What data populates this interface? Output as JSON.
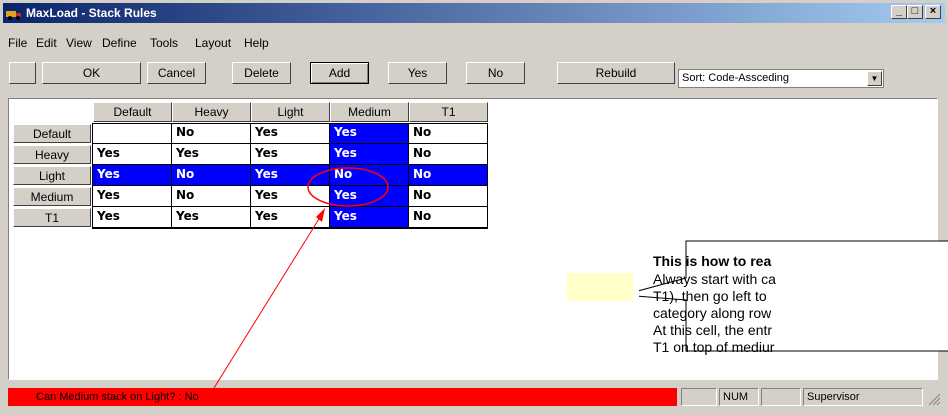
{
  "window": {
    "title": "MaxLoad - Stack Rules",
    "minimize": "_",
    "maximize": "□",
    "close": "×"
  },
  "menu": [
    "File",
    "Edit",
    "View",
    "Define",
    "Tools",
    "Layout",
    "Help"
  ],
  "toolbar": {
    "ok": "OK",
    "cancel": "Cancel",
    "delete": "Delete",
    "add": "Add",
    "yes": "Yes",
    "no": "No",
    "rebuild": "Rebuild",
    "sort_value": "Sort: Code-Assceding"
  },
  "grid": {
    "columns": [
      "Default",
      "Heavy",
      "Light",
      "Medium",
      "T1"
    ],
    "rows": [
      {
        "label": "Default",
        "values": [
          "",
          "No",
          "Yes",
          "Yes",
          "No"
        ]
      },
      {
        "label": "Heavy",
        "values": [
          "Yes",
          "Yes",
          "Yes",
          "Yes",
          "No"
        ]
      },
      {
        "label": "Light",
        "values": [
          "Yes",
          "No",
          "Yes",
          "No",
          "No"
        ]
      },
      {
        "label": "Medium",
        "values": [
          "Yes",
          "No",
          "Yes",
          "Yes",
          "No"
        ]
      },
      {
        "label": "T1",
        "values": [
          "Yes",
          "Yes",
          "Yes",
          "Yes",
          "No"
        ]
      }
    ],
    "selected_row": 2,
    "selected_column": 3
  },
  "callout": {
    "title": "This is how to rea",
    "lines": [
      "Always start with ca",
      "T1), then go left to",
      "category along row",
      "At this cell, the entr",
      "T1 on top of mediur"
    ]
  },
  "status": {
    "message": "Can Medium stack on Light? : No",
    "num": "NUM",
    "user": "Supervisor"
  },
  "colors": {
    "selection": "#0000ff",
    "status_alert": "#ff0000",
    "annotation": "#ff0000",
    "title_start": "#0a246a",
    "title_end": "#a6caf0"
  }
}
